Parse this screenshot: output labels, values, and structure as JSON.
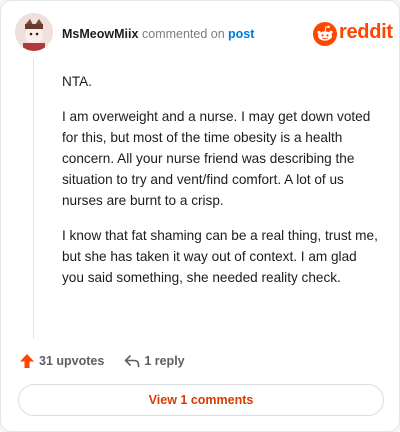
{
  "header": {
    "username": "MsMeowMiix",
    "action_text": "commented on",
    "post_link": "post",
    "brand": "reddit"
  },
  "comment": {
    "paragraphs": [
      "NTA.",
      "I am overweight and a nurse. I may get down voted for this, but most of the time obesity is a health concern. All your nurse friend was describing the situation to try and vent/find comfort. A lot of us nurses are burnt to a crisp.",
      "I know that fat shaming can be a real thing, trust me, but she has taken it way out of context. I am glad you said something, she needed reality check."
    ]
  },
  "actions": {
    "upvotes_label": "31 upvotes",
    "reply_label": "1 reply"
  },
  "footer": {
    "view_comments_label": "View 1 comments"
  },
  "colors": {
    "brand": "#ff4500",
    "link": "#0079d3",
    "view_button_text": "#d93a00"
  }
}
